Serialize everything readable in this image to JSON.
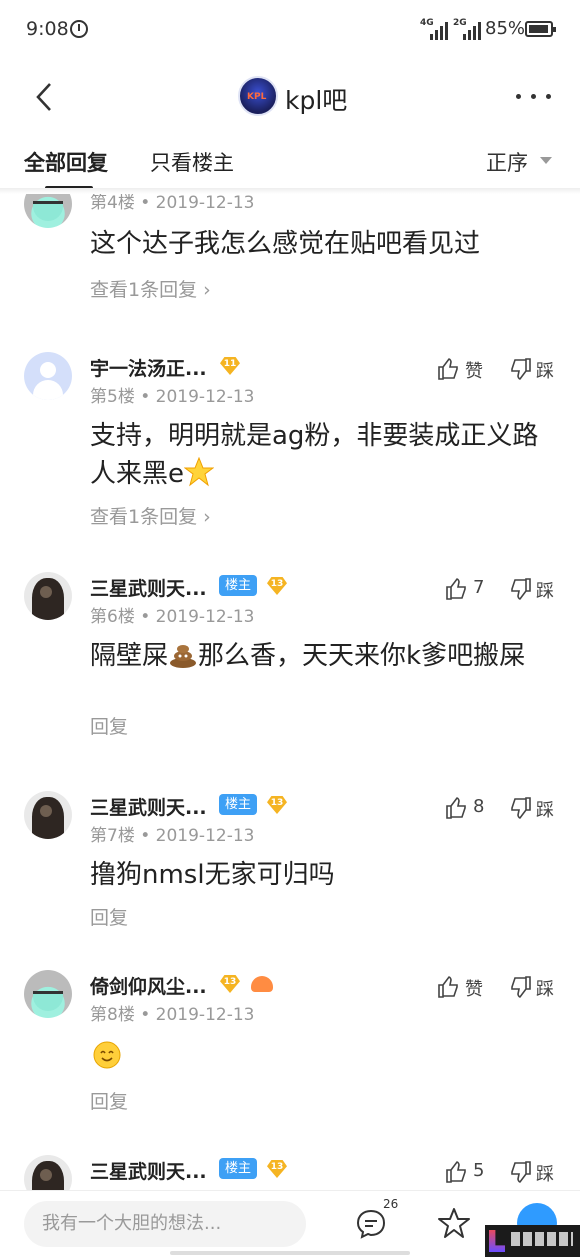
{
  "status": {
    "time": "9:08",
    "net1": "4G",
    "net2": "2G",
    "battery": "85%"
  },
  "header": {
    "forum_name": "kpl吧",
    "logo_text": "KPL"
  },
  "tabs": {
    "all_replies": "全部回复",
    "owner_only": "只看楼主",
    "sort": "正序"
  },
  "posts": [
    {
      "username": "",
      "floor": "第4楼",
      "date": "2019-12-13",
      "content": "这个达子我怎么感觉在贴吧看见过",
      "reply_link": "查看1条回复",
      "like": "",
      "dislike": ""
    },
    {
      "username": "宇一法汤正...",
      "level": "11",
      "floor": "第5楼",
      "date": "2019-12-13",
      "content": "支持，明明就是ag粉，非要装成正义路人来黑e",
      "reply_link": "查看1条回复",
      "like": "赞",
      "dislike": "踩"
    },
    {
      "username": "三星武则天...",
      "badge": "楼主",
      "level": "13",
      "floor": "第6楼",
      "date": "2019-12-13",
      "content_a": "隔壁屎",
      "content_b": "那么香，天天来你k爹吧搬屎",
      "reply_link": "回复",
      "like": "7",
      "dislike": "踩"
    },
    {
      "username": "三星武则天...",
      "badge": "楼主",
      "level": "13",
      "floor": "第7楼",
      "date": "2019-12-13",
      "content": "撸狗nmsl无家可归吗",
      "reply_link": "回复",
      "like": "8",
      "dislike": "踩"
    },
    {
      "username": "倚剑仰风尘...",
      "level": "13",
      "floor": "第8楼",
      "date": "2019-12-13",
      "reply_link": "回复",
      "like": "赞",
      "dislike": "踩"
    },
    {
      "username": "三星武则天...",
      "badge": "楼主",
      "level": "13",
      "like": "5",
      "dislike": "踩"
    }
  ],
  "bottom": {
    "placeholder": "我有一个大胆的想法...",
    "comment_count": "26"
  },
  "icons": [
    "back-icon",
    "more-icon",
    "alarm-icon",
    "signal-icon",
    "battery-icon",
    "thumb-up-icon",
    "thumb-down-icon",
    "comment-icon",
    "star-icon",
    "share-icon",
    "star-emoji",
    "poop-emoji",
    "smile-emoji"
  ],
  "colors": {
    "owner_badge": "#3ea0f5",
    "level_badge": "#f5b422",
    "accent": "#2f9bff",
    "meta_text": "#999999"
  }
}
